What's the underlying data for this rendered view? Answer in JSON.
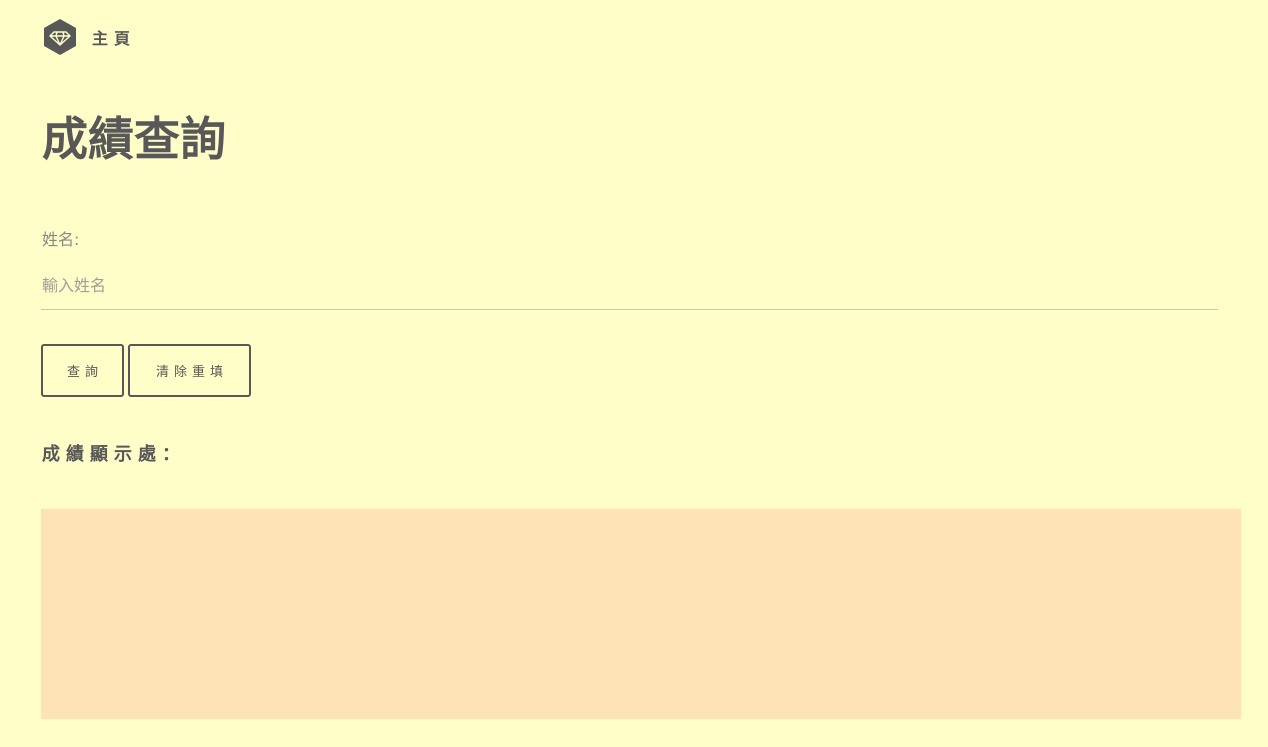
{
  "header": {
    "logo_icon": "diamond-hexagon-icon",
    "home_label": "主頁"
  },
  "page": {
    "title": "成績查詢"
  },
  "form": {
    "name_label": "姓名:",
    "name_value": "",
    "name_placeholder": "輸入姓名"
  },
  "buttons": {
    "query_label": "查詢",
    "clear_label": "清除重填"
  },
  "result": {
    "heading": "成績顯示處：",
    "content": "",
    "background_color": "#fde3b5"
  },
  "colors": {
    "background": "#fffdc8",
    "text": "#585858"
  }
}
